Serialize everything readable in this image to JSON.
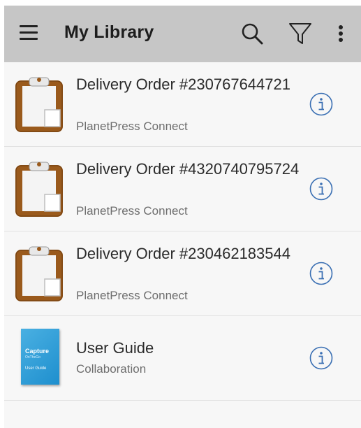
{
  "appbar": {
    "title": "My Library",
    "menu_icon": "hamburger-menu-icon",
    "search_icon": "search-icon",
    "filter_icon": "filter-icon",
    "more_icon": "more-vert-icon",
    "background": "#c6c6c6"
  },
  "items": [
    {
      "title": "Delivery Order #230767644721",
      "subtitle": "PlanetPress Connect",
      "icon": "clipboard-icon"
    },
    {
      "title": "Delivery Order #4320740795724",
      "subtitle": "PlanetPress Connect",
      "icon": "clipboard-icon"
    },
    {
      "title": "Delivery Order #230462183544",
      "subtitle": "PlanetPress Connect",
      "icon": "clipboard-icon"
    },
    {
      "title": "User Guide",
      "subtitle": "Collaboration",
      "icon": "user-guide-cover-icon",
      "cover": {
        "line1": "Capture",
        "line2": "OnTheGo",
        "line3": "User Guide"
      }
    }
  ],
  "colors": {
    "info_icon": "#3a6fb3",
    "clipboard_brown": "#9a5a1c"
  }
}
